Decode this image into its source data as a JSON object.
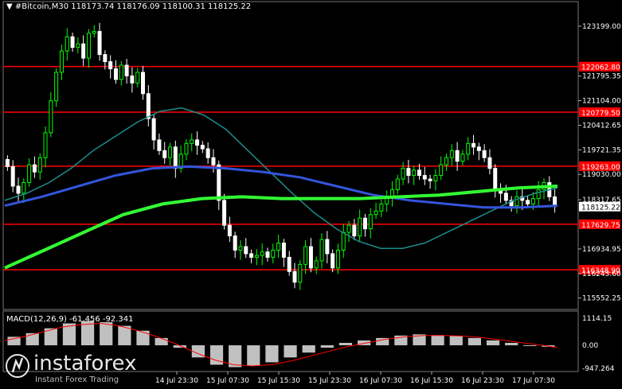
{
  "header": {
    "symbol": "#Bitcoin,M30",
    "ohlc": "118173.74 118176.09 118100.31 118125.22"
  },
  "price_axis": {
    "labels": [
      "123199.00",
      "121795.35",
      "121104.00",
      "120412.65",
      "119721.35",
      "119030.00",
      "118317.65",
      "116934.95",
      "116243.60",
      "115552.25"
    ],
    "current_price": "118125.22",
    "levels": [
      {
        "label": "122062.80",
        "price": 122062.8
      },
      {
        "label": "120779.50",
        "price": 120779.5
      },
      {
        "label": "119263.00",
        "price": 119263.0
      },
      {
        "label": "117629.75",
        "price": 117629.75
      },
      {
        "label": "116348.90",
        "price": 116348.9
      }
    ]
  },
  "time_axis": {
    "labels": [
      "14 Jul 23:30",
      "15 Jul 07:30",
      "15 Jul 15:30",
      "15 Jul 23:30",
      "16 Jul 07:30",
      "16 Jul 15:30",
      "16 Jul 23:30",
      "17 Jul 07:30"
    ]
  },
  "macd": {
    "label": "MACD(12,26,9) -61.456 -92.341",
    "axis_labels": [
      "1114.15",
      "0.00",
      "-947.264"
    ]
  },
  "logo": {
    "brand": "instaforex",
    "tagline": "Instant Forex Trading"
  },
  "colors": {
    "background": "#000000",
    "bull_candle": "#00ff00",
    "bear_candle": "#ffffff",
    "level_line": "#ff0000",
    "ma_fast": "#1e8c8c",
    "ma_mid": "#3355dd",
    "ma_slow": "#33ff33",
    "macd_hist": "#c0c0c0",
    "macd_signal": "#ff0000"
  },
  "chart_data": {
    "type": "candlestick",
    "ylim": [
      115300,
      123800
    ],
    "close": [
      119250,
      118700,
      118500,
      118800,
      119300,
      119100,
      119500,
      120200,
      121100,
      121900,
      122500,
      122900,
      122600,
      122700,
      122300,
      123000,
      123050,
      122400,
      122200,
      122000,
      121700,
      122100,
      121800,
      121600,
      121900,
      121300,
      120600,
      120000,
      119700,
      119500,
      119800,
      119200,
      119600,
      119900,
      120000,
      119850,
      119750,
      119500,
      119300,
      118300,
      117600,
      117300,
      116900,
      117000,
      116800,
      116700,
      116750,
      116850,
      116700,
      116900,
      117100,
      116700,
      116300,
      116000,
      116500,
      117000,
      116400,
      116600,
      117200,
      116800,
      116400,
      116900,
      117400,
      117600,
      117300,
      117800,
      117500,
      117900,
      118000,
      118200,
      118400,
      118600,
      118900,
      119200,
      119000,
      119150,
      119000,
      118900,
      118850,
      119000,
      119300,
      119500,
      119700,
      119400,
      119600,
      119900,
      119800,
      119700,
      119500,
      119200,
      118600,
      118500,
      118300,
      118150,
      118400,
      118300,
      118200,
      118350,
      118600,
      118800,
      118400,
      118125
    ],
    "ma_fast": [
      118300,
      118500,
      118800,
      119200,
      119700,
      120100,
      120500,
      120800,
      120900,
      120700,
      120300,
      119700,
      119100,
      118500,
      117950,
      117500,
      117150,
      116950,
      116950,
      117100,
      117400,
      117700,
      118000,
      118300,
      118500,
      118650
    ],
    "ma_mid": [
      118150,
      118400,
      118700,
      119000,
      119200,
      119250,
      119200,
      119100,
      118950,
      118700,
      118450,
      118300,
      118200,
      118100,
      118100,
      118150
    ],
    "ma_slow": [
      116400,
      116900,
      117400,
      117900,
      118200,
      118350,
      118400,
      118350,
      118350,
      118350,
      118400,
      118450,
      118550,
      118650,
      118700
    ],
    "macd_hist": [
      350,
      500,
      700,
      900,
      1000,
      950,
      800,
      600,
      300,
      -100,
      -500,
      -800,
      -900,
      -850,
      -700,
      -500,
      -300,
      -100,
      100,
      200,
      300,
      400,
      450,
      420,
      380,
      300,
      200,
      100,
      0,
      -60
    ],
    "macd_signal": [
      200,
      350,
      550,
      750,
      850,
      900,
      800,
      600,
      350,
      50,
      -300,
      -600,
      -800,
      -850,
      -800,
      -650,
      -450,
      -250,
      -50,
      100,
      250,
      350,
      400,
      400,
      380,
      320,
      220,
      120,
      20,
      -92
    ]
  }
}
